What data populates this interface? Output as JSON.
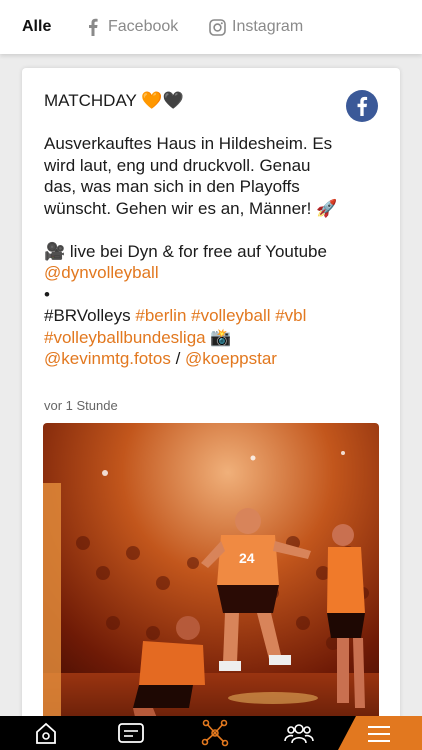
{
  "tabs": [
    {
      "label": "Alle",
      "active": true
    },
    {
      "label": "Facebook",
      "icon": "facebook-f-icon"
    },
    {
      "label": "Instagram",
      "icon": "instagram-icon"
    }
  ],
  "post": {
    "source_icon": "facebook-icon",
    "title": "MATCHDAY 🧡🖤",
    "para1": "Ausverkauftes Haus in Hildesheim. Es wird laut, eng und druckvoll. Genau das, was man sich in den Playoffs wünscht. Gehen wir es an, Männer! 🚀",
    "live_prefix": "🎥 live bei Dyn & for free auf Youtube ",
    "live_mention": "@dynvolleyball",
    "bullet": "•",
    "tag_plain": "#BRVolleys ",
    "tags_orange_1": "#berlin #volleyball #vbl",
    "tags_orange_2": "#volleyballbundesliga",
    "camera_emoji": " 📸",
    "mention_1": "@kevinmtg.fotos",
    "slash": " / ",
    "mention_2": "@koeppstar",
    "time": "vor 1 Stunde",
    "photo_jersey_number": "24"
  },
  "nav": [
    "home-icon",
    "news-icon",
    "network-icon",
    "team-icon",
    "menu-icon"
  ],
  "colors": {
    "accent": "#e2781f",
    "facebook": "#3b5998",
    "navbar": "#000000"
  }
}
